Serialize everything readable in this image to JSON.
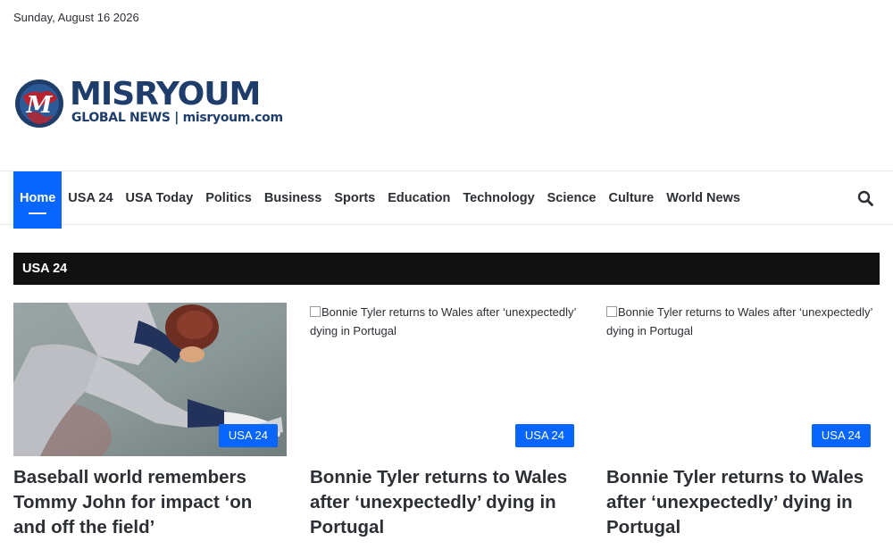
{
  "topbar": {
    "date": "Sunday, August 16 2026"
  },
  "logo": {
    "title": "MISRYOUM",
    "subtitle": "GLOBAL NEWS | misryoum.com",
    "colors": {
      "navy": "#1f3d6b",
      "red": "#b8232f"
    }
  },
  "nav": {
    "items": [
      {
        "label": "Home",
        "active": true
      },
      {
        "label": "USA 24"
      },
      {
        "label": "USA Today"
      },
      {
        "label": "Politics"
      },
      {
        "label": "Business"
      },
      {
        "label": "Sports"
      },
      {
        "label": "Education"
      },
      {
        "label": "Technology"
      },
      {
        "label": "Science"
      },
      {
        "label": "Culture"
      },
      {
        "label": "World News"
      }
    ],
    "search_icon": "search-icon",
    "accent": "#0866ff"
  },
  "section": {
    "title": "USA 24"
  },
  "cards": [
    {
      "badge": "USA 24",
      "title": "Baseball world remembers Tommy John for impact ‘on and off the field’",
      "image": "baseball-pitcher-photo"
    },
    {
      "badge": "USA 24",
      "title": "Bonnie Tyler returns to Wales after ‘unexpectedly’ dying in Portugal",
      "image_alt": "Bonnie Tyler returns to Wales after ‘unexpectedly’ dying in Portugal"
    },
    {
      "badge": "USA 24",
      "title": "Bonnie Tyler returns to Wales after ‘unexpectedly’ dying in Portugal",
      "image_alt": "Bonnie Tyler returns to Wales after ‘unexpectedly’ dying in Portugal"
    }
  ]
}
